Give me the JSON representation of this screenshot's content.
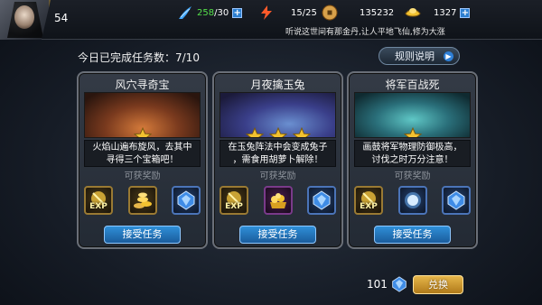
{
  "player": {
    "level": "54"
  },
  "resources": {
    "stamina": {
      "current": "258",
      "max": "/30",
      "icon": "stamina-wing-icon"
    },
    "energy": {
      "value": "15/25",
      "icon": "energy-icon"
    },
    "coins": {
      "value": "135232",
      "icon": "copper-coin-icon"
    },
    "gold": {
      "value": "1327",
      "icon": "gold-ingot-icon"
    },
    "plus": "+"
  },
  "marquee": "听说这世间有那金丹,让人平地飞仙,修为大涨",
  "progress": {
    "label": "今日已完成任务数：7/10"
  },
  "rules_button": {
    "label": "规则说明"
  },
  "cards": [
    {
      "title": "风穴寻奇宝",
      "stars": 1,
      "desc_line1": "火焰山遍布旋风，去其中",
      "desc_line2": "寻得三个宝箱吧！",
      "rewards_label": "可获奖励",
      "rewards": [
        "exp",
        "gold-coins",
        "blue-gem"
      ],
      "button": "接受任务"
    },
    {
      "title": "月夜擒玉兔",
      "stars": 3,
      "desc_line1": "在玉兔阵法中会变成兔子",
      "desc_line2": "，需食用胡萝卜解除！",
      "rewards_label": "可获奖励",
      "rewards": [
        "exp",
        "treasure",
        "blue-gem"
      ],
      "button": "接受任务"
    },
    {
      "title": "将军百战死",
      "stars": 1,
      "desc_line1": "画鼓将军物理防御极高，",
      "desc_line2": "讨伐之时万分注意！",
      "rewards_label": "可获奖励",
      "rewards": [
        "exp",
        "spirit-orb",
        "blue-gem"
      ],
      "button": "接受任务"
    }
  ],
  "exp_text": "EXP",
  "bottom": {
    "currency_amount": "101",
    "exchange_button": "兑换"
  },
  "colors": {
    "accent_blue": "#2f8fd8",
    "stamina_green": "#55e04a",
    "gold": "#e6b64a"
  }
}
